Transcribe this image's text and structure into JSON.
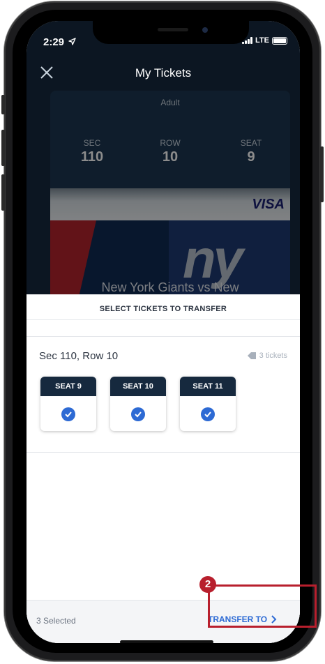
{
  "status": {
    "time": "2:29",
    "network": "LTE"
  },
  "nav": {
    "title": "My Tickets"
  },
  "ticket": {
    "type": "Adult",
    "sec_label": "SEC",
    "sec_value": "110",
    "row_label": "ROW",
    "row_value": "10",
    "seat_label": "SEAT",
    "seat_value": "9",
    "sponsor": "VISA",
    "team_logo": "ny",
    "game_title": "New York Giants vs New"
  },
  "sheet": {
    "title": "SELECT TICKETS TO TRANSFER",
    "section_row": "Sec 110, Row 10",
    "ticket_count": "3 tickets",
    "seats": [
      {
        "label": "SEAT 9",
        "selected": true
      },
      {
        "label": "SEAT 10",
        "selected": true
      },
      {
        "label": "SEAT 11",
        "selected": true
      }
    ]
  },
  "footer": {
    "selected_text": "3 Selected",
    "transfer_label": "TRANSFER TO"
  },
  "annotation": {
    "step": "2"
  },
  "colors": {
    "navy": "#16293e",
    "accent": "#2d6ad4",
    "highlight": "#b81f2d"
  }
}
